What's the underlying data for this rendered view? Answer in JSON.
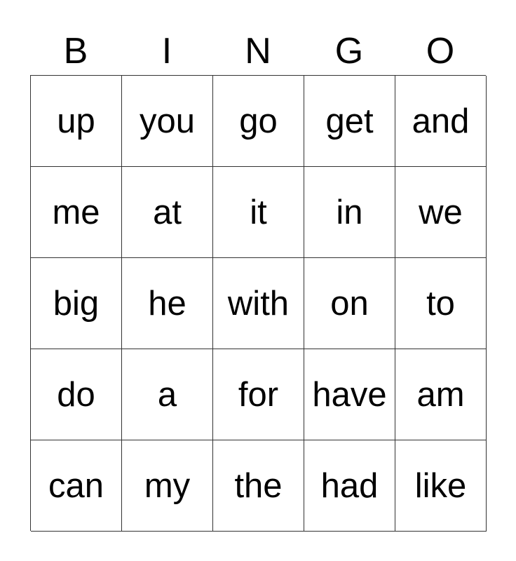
{
  "header": [
    "B",
    "I",
    "N",
    "G",
    "O"
  ],
  "rows": [
    [
      "up",
      "you",
      "go",
      "get",
      "and"
    ],
    [
      "me",
      "at",
      "it",
      "in",
      "we"
    ],
    [
      "big",
      "he",
      "with",
      "on",
      "to"
    ],
    [
      "do",
      "a",
      "for",
      "have",
      "am"
    ],
    [
      "can",
      "my",
      "the",
      "had",
      "like"
    ]
  ]
}
